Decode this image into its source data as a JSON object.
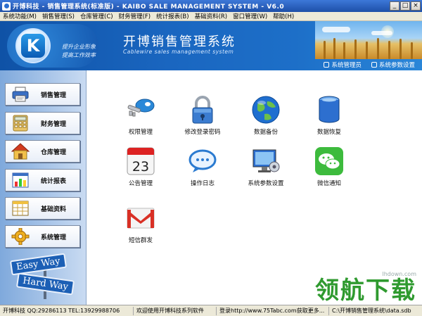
{
  "window": {
    "title": "开博科技 - 销售管理系统(标准版) - KAIBO SALE MANAGEMENT SYSTEM - V6.0",
    "minimize": "_",
    "maximize": "□",
    "close": "×"
  },
  "menu": [
    "系统功能(M)",
    "销售管理(S)",
    "仓库管理(C)",
    "财务管理(F)",
    "统计报表(B)",
    "基础资料(R)",
    "窗口管理(W)",
    "帮助(H)"
  ],
  "banner": {
    "logo_letter": "K",
    "slogan_1": "提升企业形象",
    "slogan_2": "提高工作效率",
    "title": "开博销售管理系统",
    "subtitle": "Cablewire sales management system",
    "user_link": "系统管理员",
    "settings_link": "系统参数设置"
  },
  "sidebar": {
    "items": [
      {
        "label": "销售管理",
        "icon": "printer-icon"
      },
      {
        "label": "财务管理",
        "icon": "calculator-icon"
      },
      {
        "label": "仓库管理",
        "icon": "house-icon"
      },
      {
        "label": "统计报表",
        "icon": "bar-chart-icon"
      },
      {
        "label": "基础资料",
        "icon": "grid-table-icon"
      },
      {
        "label": "系统管理",
        "icon": "gear-icon"
      }
    ],
    "sign_1": "Easy Way",
    "sign_2": "Hard Way"
  },
  "tiles": [
    {
      "label": "权限管理",
      "icon": "key-icon"
    },
    {
      "label": "修改登录密码",
      "icon": "padlock-icon"
    },
    {
      "label": "数据备份",
      "icon": "globe-icon"
    },
    {
      "label": "数据恢复",
      "icon": "database-icon"
    },
    {
      "label": "公告管理",
      "icon": "calendar-icon",
      "day": "23"
    },
    {
      "label": "操作日志",
      "icon": "chat-bubble-icon"
    },
    {
      "label": "系统参数设置",
      "icon": "monitor-settings-icon"
    },
    {
      "label": "微信通知",
      "icon": "wechat-icon"
    },
    {
      "label": "短信群发",
      "icon": "gmail-icon"
    }
  ],
  "status": [
    "开博科技 QQ:29286113 TEL:13929988706",
    "欢迎使用开博科技系列软件",
    "登录http://www.75Tabc.com获取更多...",
    "C:\\开博销售管理系统\\data.sdb"
  ],
  "watermark": {
    "url": "lhdown.com",
    "text": "领航下载"
  },
  "colors": {
    "banner_blue": "#1a66c0",
    "watermark_green": "#2f9a2f"
  }
}
